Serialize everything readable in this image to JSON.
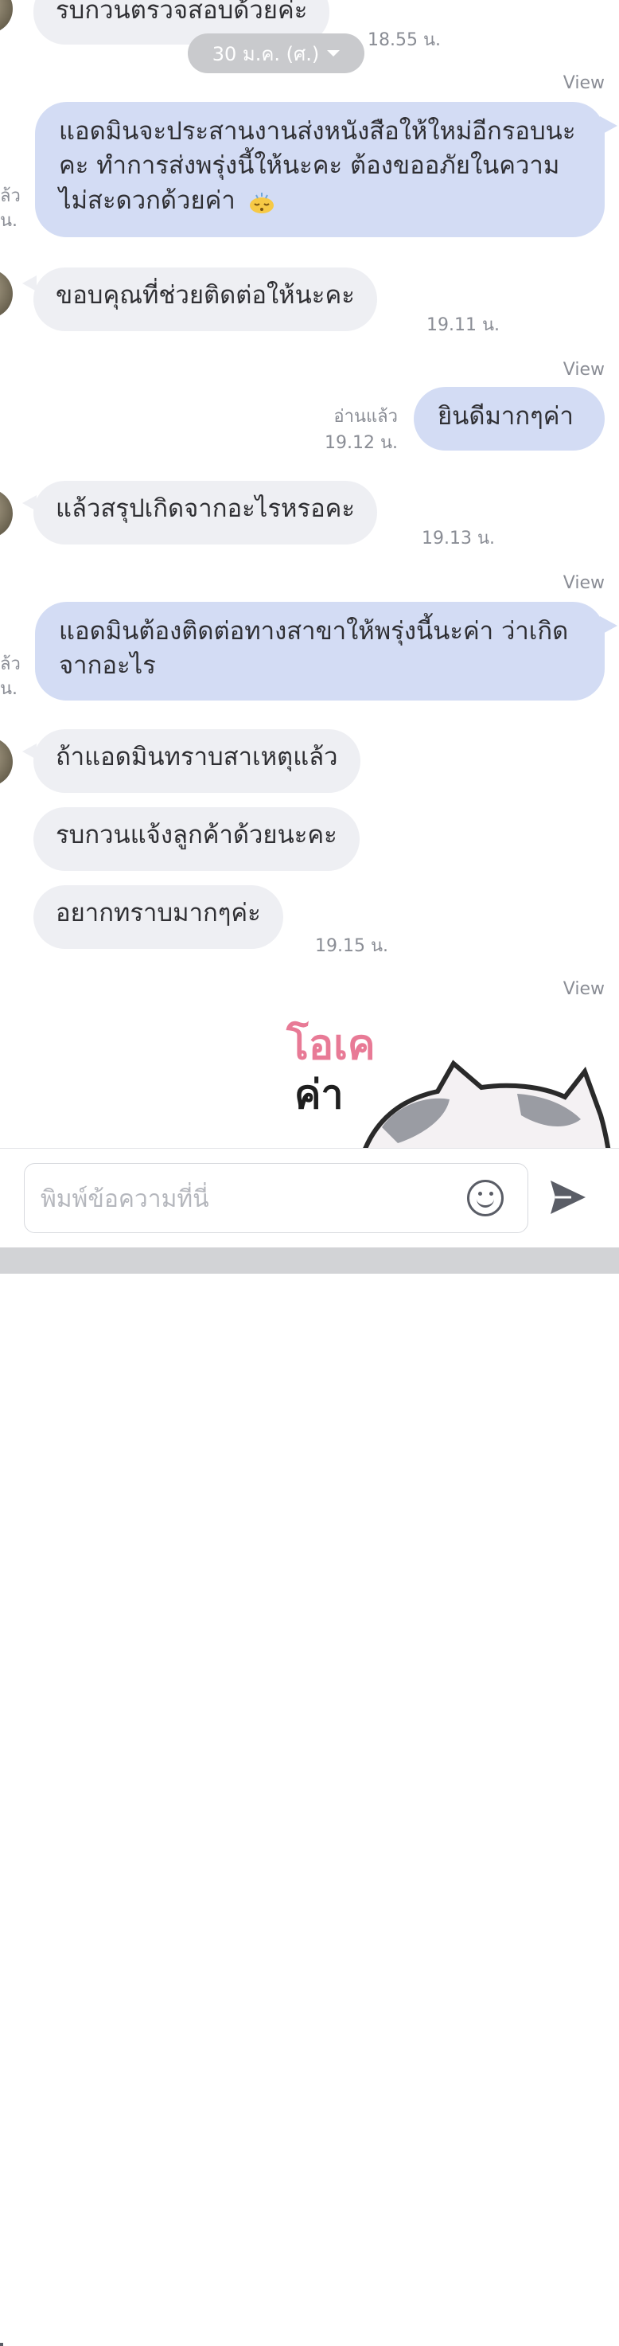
{
  "date_chip": {
    "label": "30 ม.ค. (ศ.)"
  },
  "messages": {
    "m0": {
      "text": "รบกวนตรวจสอบด้วยค่ะ",
      "time": "18.55 น."
    },
    "m1": {
      "text": "แอดมินจะประสานงานส่งหนังสือให้ใหม่อีกรอบนะคะ ทำการส่งพรุ่งนี้ให้นะคะ ต้องขออภัยในความไม่สะดวกด้วยค่า",
      "view": "View",
      "edge_read": "ล้ว",
      "edge_time": "น."
    },
    "m2": {
      "text": "ขอบคุณที่ช่วยติดต่อให้นะคะ",
      "time": "19.11 น."
    },
    "m3": {
      "text": "ยินดีมากๆค่า",
      "view": "View",
      "read": "อ่านแล้ว",
      "time": "19.12 น."
    },
    "m4": {
      "text": "แล้วสรุปเกิดจากอะไรหรอคะ",
      "time": "19.13 น."
    },
    "m5": {
      "text": "แอดมินต้องติดต่อทางสาขาให้พรุ่งนี้นะค่า ว่าเกิดจากอะไร",
      "view": "View",
      "edge_read": "ล้ว",
      "edge_time": "น."
    },
    "m6": {
      "text": "ถ้าแอดมินทราบสาเหตุแล้ว"
    },
    "m7": {
      "text": "รบกวนแจ้งลูกค้าด้วยนะคะ"
    },
    "m8": {
      "text": "อยากทราบมากๆค่ะ",
      "time": "19.15 น."
    },
    "m9": {
      "view": "View",
      "sticker_line1": "โอเค",
      "sticker_line2": "ค่า"
    }
  },
  "composer": {
    "placeholder": "พิมพ์ข้อความที่นี่",
    "emoji_icon": "smiley-icon",
    "send_icon": "send-icon"
  },
  "colors": {
    "outgoing": "#d3dcf4",
    "incoming": "#eeeff3",
    "sticker_pink": "#e87a96"
  }
}
